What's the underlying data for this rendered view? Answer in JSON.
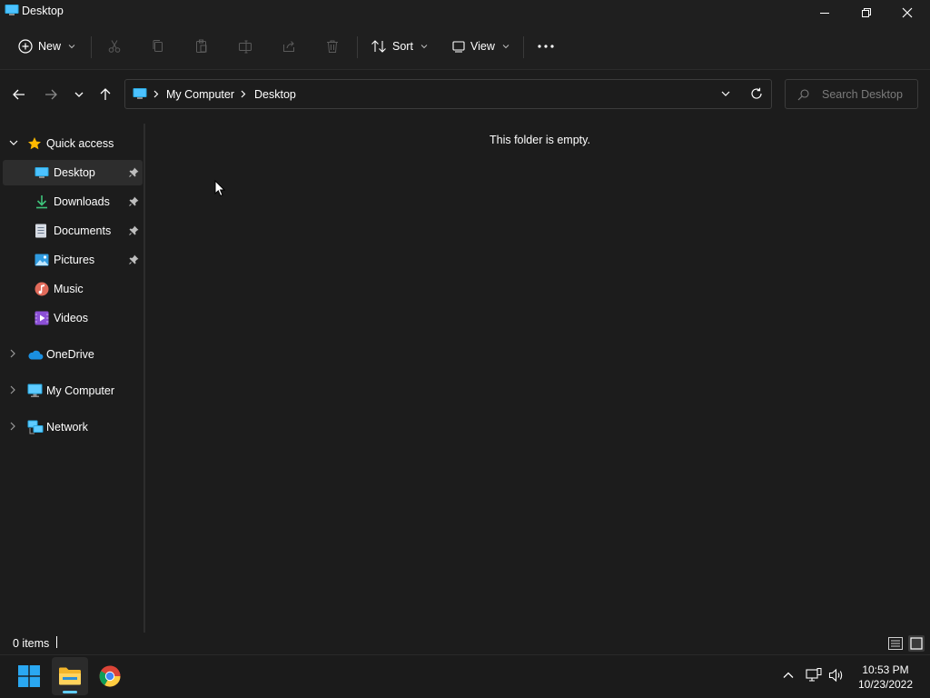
{
  "window": {
    "title": "Desktop"
  },
  "toolbar": {
    "new_label": "New",
    "sort_label": "Sort",
    "view_label": "View",
    "icons": [
      "cut-icon",
      "copy-icon",
      "paste-icon",
      "rename-icon",
      "share-icon",
      "delete-icon"
    ]
  },
  "address": {
    "crumbs": [
      "My Computer",
      "Desktop"
    ]
  },
  "search": {
    "placeholder": "Search Desktop"
  },
  "sidebar": {
    "quick_access": "Quick access",
    "items": [
      {
        "label": "Desktop",
        "icon": "desktop-icon",
        "pinned": true,
        "selected": true
      },
      {
        "label": "Downloads",
        "icon": "downloads-icon",
        "pinned": true
      },
      {
        "label": "Documents",
        "icon": "documents-icon",
        "pinned": true
      },
      {
        "label": "Pictures",
        "icon": "pictures-icon",
        "pinned": true
      },
      {
        "label": "Music",
        "icon": "music-icon"
      },
      {
        "label": "Videos",
        "icon": "videos-icon"
      }
    ],
    "onedrive": "OneDrive",
    "my_computer": "My Computer",
    "network": "Network"
  },
  "content": {
    "empty_message": "This folder is empty."
  },
  "status": {
    "item_count": "0 items"
  },
  "taskbar": {
    "time": "10:53 PM",
    "date": "10/23/2022"
  },
  "colors": {
    "accent": "#60cdff",
    "folder": "#ffc83d",
    "star": "#ffb900"
  }
}
